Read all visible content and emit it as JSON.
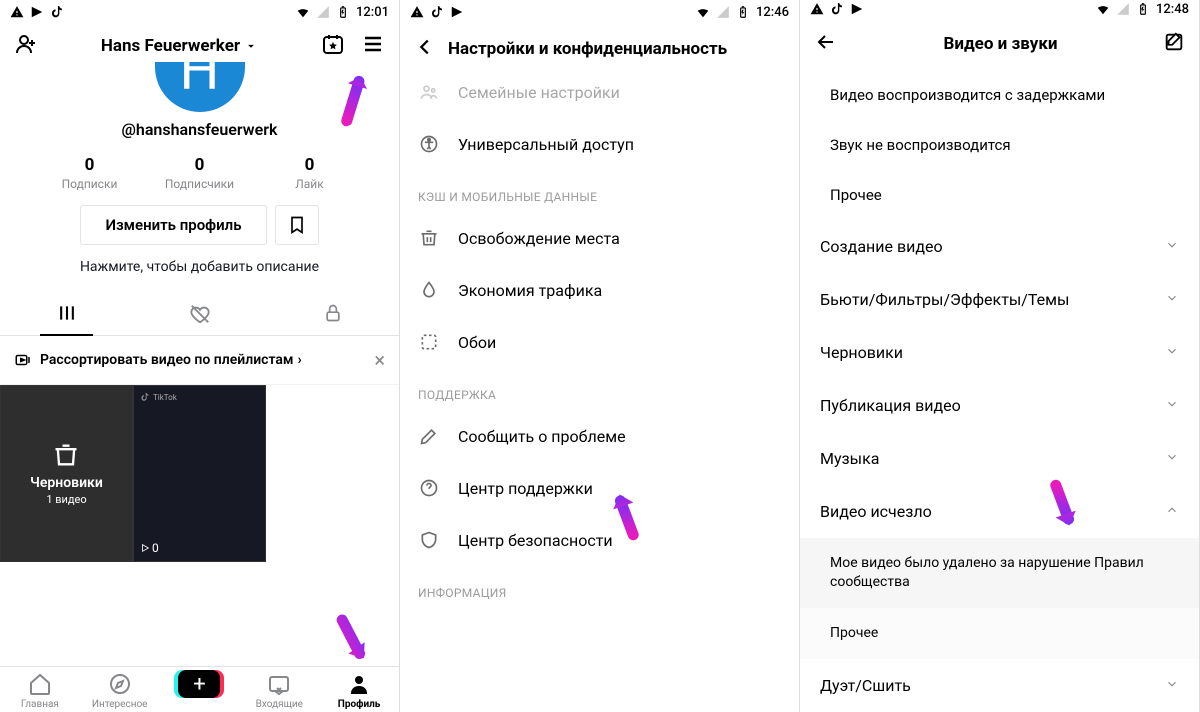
{
  "screen1": {
    "status_time": "12:01",
    "display_name": "Hans Feuerwerker",
    "handle": "@hanshansfeuerwerk",
    "stats": [
      {
        "num": "0",
        "label": "Подписки"
      },
      {
        "num": "0",
        "label": "Подписчики"
      },
      {
        "num": "0",
        "label": "Лайк"
      }
    ],
    "edit_profile_label": "Изменить профиль",
    "bio_hint": "Нажмите, чтобы добавить описание",
    "playlist_hint": "Рассортировать видео по плейлистам",
    "drafts_label": "Черновики",
    "drafts_count": "1 видео",
    "play_count": "0",
    "nav": {
      "home": "Главная",
      "discover": "Интересное",
      "inbox": "Входящие",
      "profile": "Профиль"
    }
  },
  "screen2": {
    "status_time": "12:46",
    "title": "Настройки и конфиденциальность",
    "items_top": [
      "Семейные настройки",
      "Универсальный доступ"
    ],
    "section_cache": "КЭШ И МОБИЛЬНЫЕ ДАННЫЕ",
    "items_cache": [
      "Освобождение места",
      "Экономия трафика",
      "Обои"
    ],
    "section_support": "ПОДДЕРЖКА",
    "items_support": [
      "Сообщить о проблеме",
      "Центр поддержки",
      "Центр безопасности"
    ],
    "section_info": "ИНФОРМАЦИЯ"
  },
  "screen3": {
    "status_time": "12:48",
    "title": "Видео и звуки",
    "sub_items": [
      "Видео воспроизводится с задержками",
      "Звук не воспроизводится",
      "Прочее"
    ],
    "expand_items": [
      "Создание видео",
      "Бьюти/Фильтры/Эффекты/Темы",
      "Черновики",
      "Публикация видео",
      "Музыка"
    ],
    "expanded_active": "Видео исчезло",
    "expanded_sub1": "Мое видео было удалено за нарушение Правил сообщества",
    "expanded_sub2": "Прочее",
    "last_item": "Дуэт/Сшить"
  }
}
